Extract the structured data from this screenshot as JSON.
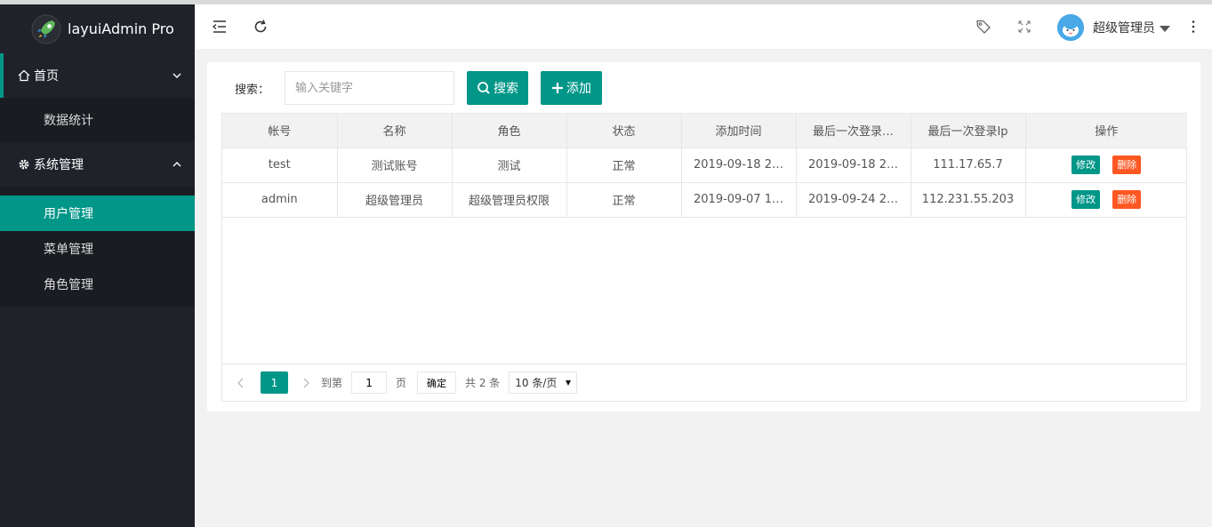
{
  "app": {
    "title": "layuiAdmin Pro"
  },
  "sidebar": {
    "home": {
      "label": "首页",
      "children": [
        "数据统计"
      ]
    },
    "system": {
      "label": "系统管理",
      "children": [
        "用户管理",
        "菜单管理",
        "角色管理"
      ]
    }
  },
  "header": {
    "user_name": "超级管理员"
  },
  "search": {
    "label": "搜索：",
    "placeholder": "输入关键字",
    "search_button": "搜索",
    "add_button": "添加"
  },
  "table": {
    "columns": [
      "帐号",
      "名称",
      "角色",
      "状态",
      "添加时间",
      "最后一次登录…",
      "最后一次登录Ip",
      "操作"
    ],
    "rows": [
      [
        "test",
        "测试账号",
        "测试",
        "正常",
        "2019-09-18 2…",
        "2019-09-18 2…",
        "111.17.65.7"
      ],
      [
        "admin",
        "超级管理员",
        "超级管理员权限",
        "正常",
        "2019-09-07 1…",
        "2019-09-24 2…",
        "112.231.55.203"
      ]
    ],
    "edit_label": "修改",
    "delete_label": "删除"
  },
  "pager": {
    "current": "1",
    "goto_label": "到第",
    "page_input": "1",
    "page_unit": "页",
    "confirm": "确定",
    "total": "共 2 条",
    "per_page": "10 条/页"
  },
  "colors": {
    "primary": "#009688",
    "danger": "#ff5722",
    "sidebar_bg": "#20222a"
  }
}
